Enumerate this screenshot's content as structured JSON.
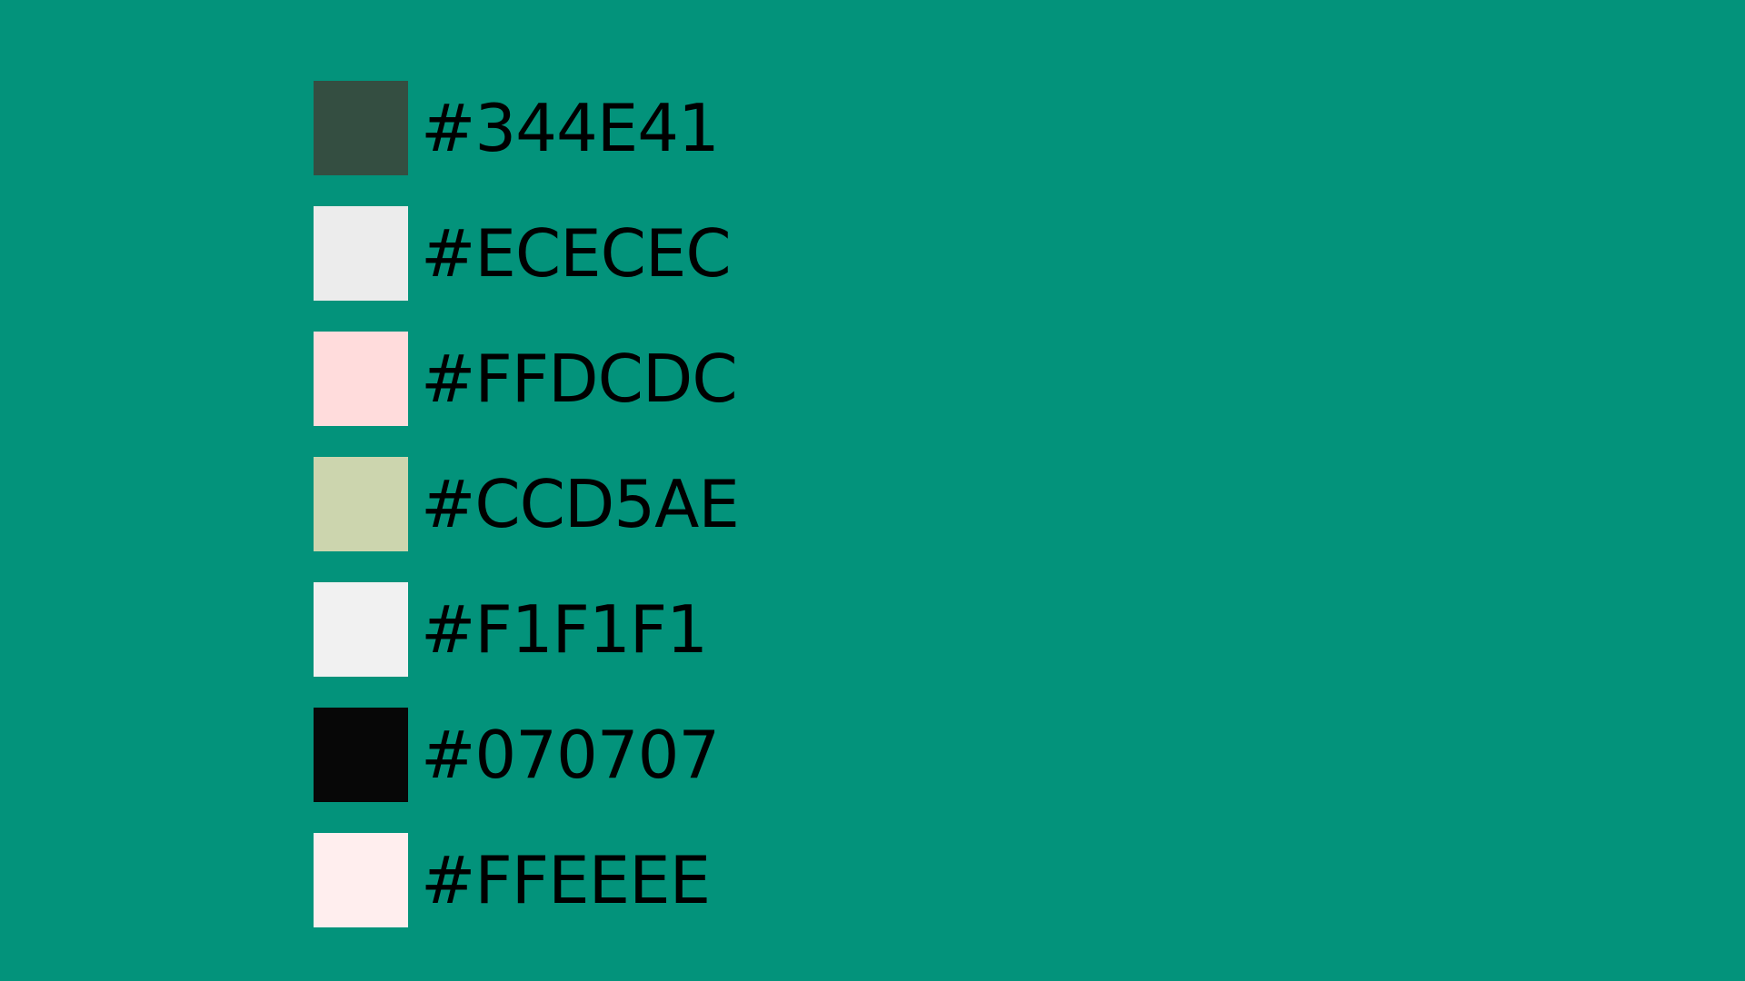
{
  "background": "#03937b",
  "text_color": "#000000",
  "swatches": [
    {
      "color": "#344E41",
      "label": "#344E41"
    },
    {
      "color": "#ECECEC",
      "label": "#ECECEC"
    },
    {
      "color": "#FFDCDC",
      "label": "#FFDCDC"
    },
    {
      "color": "#CCD5AE",
      "label": "#CCD5AE"
    },
    {
      "color": "#F1F1F1",
      "label": "#F1F1F1"
    },
    {
      "color": "#070707",
      "label": "#070707"
    },
    {
      "color": "#FFEEEE",
      "label": "#FFEEEE"
    }
  ]
}
